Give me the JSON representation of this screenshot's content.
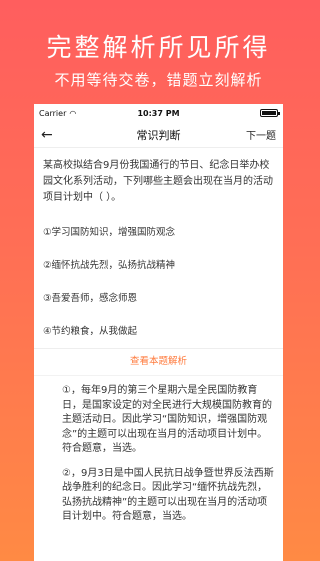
{
  "promo": {
    "title": "完整解析所见所得",
    "subtitle": "不用等待交卷，错题立刻解析"
  },
  "status_bar": {
    "carrier": "Carrier",
    "time": "10:37 PM",
    "battery_level": 1.0
  },
  "nav": {
    "title": "常识判断",
    "next_label": "下一题"
  },
  "question": {
    "text": "某高校拟结合9月份我国通行的节日、纪念日举办校园文化系列活动，下列哪些主题会出现在当月的活动项目计划中（ ）。",
    "options": [
      "①学习国防知识，增强国防观念",
      "②缅怀抗战先烈，弘扬抗战精神",
      "③吾爱吾师，感念师恩",
      "④节约粮食，从我做起"
    ]
  },
  "analysis": {
    "link_label": "查看本题解析",
    "paragraphs": [
      "①，每年9月的第三个星期六是全民国防教育日，是国家设定的对全民进行大规模国防教育的主题活动日。因此学习“国防知识，增强国防观念”的主题可以出现在当月的活动项目计划中。符合题意，当选。",
      "②，9月3日是中国人民抗日战争暨世界反法西斯战争胜利的纪念日。因此学习“缅怀抗战先烈，弘扬抗战精神”的主题可以出现在当月的活动项目计划中。符合题意，当选。"
    ]
  }
}
